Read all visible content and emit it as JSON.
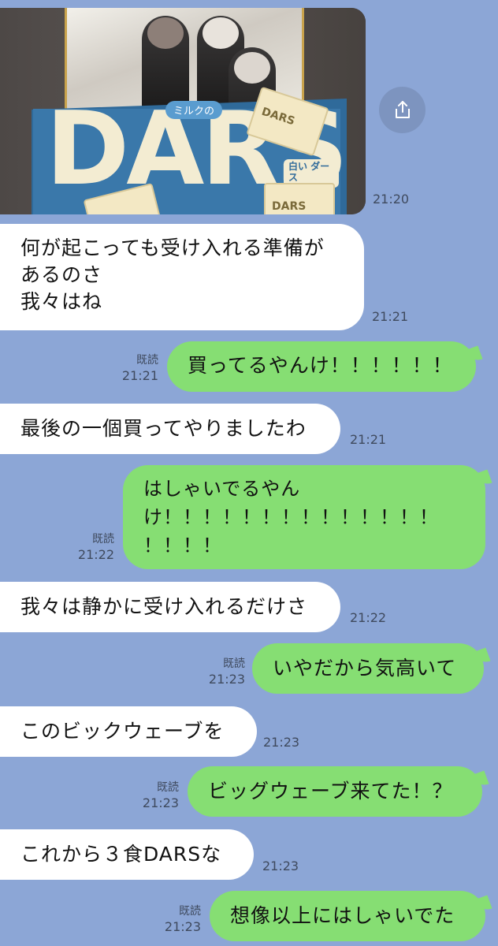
{
  "messages": [
    {
      "id": "photo",
      "side": "in",
      "type": "image",
      "time": "21:20",
      "image_text": {
        "brand": "DARS",
        "sub": "白い ダース",
        "ribbon": "ミルクの",
        "choc_a": "DARS",
        "choc_b": "DARS"
      }
    },
    {
      "id": "m1",
      "side": "in",
      "text": "何が起こっても受け入れる準備が\nあるのさ\n我々はね",
      "time": "21:21"
    },
    {
      "id": "m2",
      "side": "out",
      "text": "買ってるやんけ！！！！！！",
      "read": "既読",
      "time": "21:21"
    },
    {
      "id": "m3",
      "side": "in",
      "text": "最後の一個買ってやりましたわ",
      "time": "21:21"
    },
    {
      "id": "m4",
      "side": "out",
      "text": "はしゃいでるやん\nけ！！！！！！！！！！！！！！\n！！！！",
      "read": "既読",
      "time": "21:22"
    },
    {
      "id": "m5",
      "side": "in",
      "text": "我々は静かに受け入れるだけさ",
      "time": "21:22"
    },
    {
      "id": "m6",
      "side": "out",
      "text": "いやだから気高いて",
      "read": "既読",
      "time": "21:23"
    },
    {
      "id": "m7",
      "side": "in",
      "text": "このビックウェーブを",
      "time": "21:23"
    },
    {
      "id": "m8",
      "side": "out",
      "text": "ビッグウェーブ来てた！？",
      "read": "既読",
      "time": "21:23"
    },
    {
      "id": "m9",
      "side": "in",
      "text": "これから３食DARSな",
      "time": "21:23"
    },
    {
      "id": "m10",
      "side": "out",
      "text": "想像以上にはしゃいでた",
      "read": "既読",
      "time": "21:23"
    }
  ],
  "icons": {
    "share": "share-icon"
  },
  "colors": {
    "background": "#8ca6d6",
    "incoming": "#ffffff",
    "outgoing": "#86de73",
    "meta_text": "#3f4a5e"
  }
}
